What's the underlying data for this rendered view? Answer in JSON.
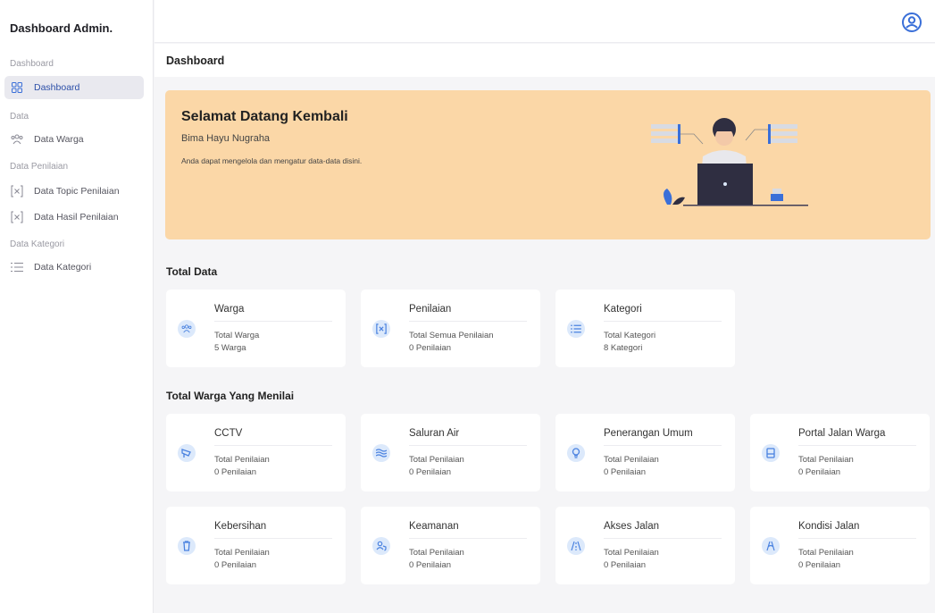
{
  "sidebar": {
    "brand": "Dashboard Admin.",
    "sections": {
      "dashboard": "Dashboard",
      "data": "Data",
      "penilaian": "Data Penilaian",
      "kategori": "Data Kategori"
    },
    "items": {
      "dashboard": "Dashboard",
      "warga": "Data Warga",
      "topic": "Data Topic Penilaian",
      "hasil": "Data Hasil Penilaian",
      "kategori": "Data Kategori"
    }
  },
  "header": {
    "title": "Dashboard"
  },
  "banner": {
    "title": "Selamat Datang Kembali",
    "name": "Bima Hayu Nugraha",
    "description": "Anda dapat mengelola dan mengatur data-data disini."
  },
  "total_data": {
    "title": "Total Data",
    "cards": [
      {
        "title": "Warga",
        "label": "Total Warga",
        "value": "5 Warga",
        "icon": "users-icon"
      },
      {
        "title": "Penilaian",
        "label": "Total Semua Penilaian",
        "value": "0 Penilaian",
        "icon": "brackets-x-icon"
      },
      {
        "title": "Kategori",
        "label": "Total Kategori",
        "value": "8 Kategori",
        "icon": "list-icon"
      }
    ]
  },
  "warga_menilai": {
    "title": "Total Warga Yang Menilai",
    "cards": [
      {
        "title": "CCTV",
        "label": "Total Penilaian",
        "value": "0 Penilaian",
        "icon": "cctv-icon"
      },
      {
        "title": "Saluran Air",
        "label": "Total Penilaian",
        "value": "0 Penilaian",
        "icon": "water-icon"
      },
      {
        "title": "Penerangan Umum",
        "label": "Total Penilaian",
        "value": "0 Penilaian",
        "icon": "lamp-icon"
      },
      {
        "title": "Portal Jalan Warga",
        "label": "Total Penilaian",
        "value": "0 Penilaian",
        "icon": "gate-icon"
      },
      {
        "title": "Kebersihan",
        "label": "Total Penilaian",
        "value": "0 Penilaian",
        "icon": "trash-icon"
      },
      {
        "title": "Keamanan",
        "label": "Total Penilaian",
        "value": "0 Penilaian",
        "icon": "shield-user-icon"
      },
      {
        "title": "Akses Jalan",
        "label": "Total Penilaian",
        "value": "0 Penilaian",
        "icon": "road-icon"
      },
      {
        "title": "Kondisi Jalan",
        "label": "Total Penilaian",
        "value": "0 Penilaian",
        "icon": "road-condition-icon"
      }
    ]
  },
  "colors": {
    "accent": "#3a6fd8",
    "banner": "#fbd7a7",
    "icon_bg": "#dce9fb"
  }
}
